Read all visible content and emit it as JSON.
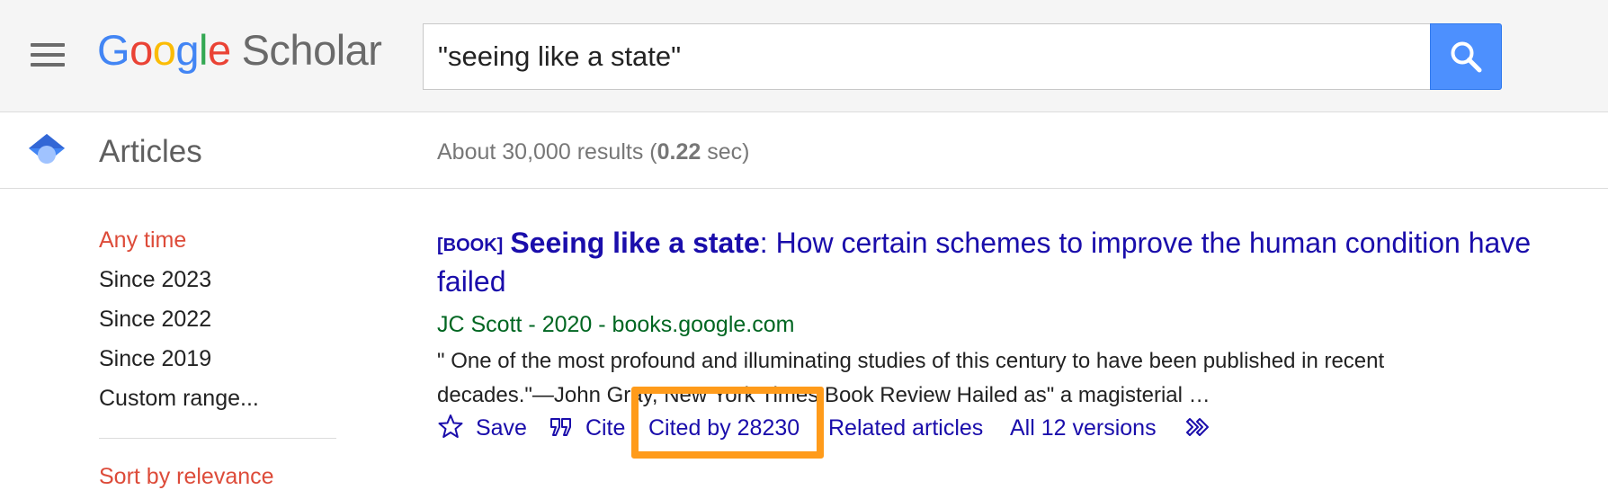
{
  "header": {
    "logo_letters": [
      "G",
      "o",
      "o",
      "g",
      "l",
      "e"
    ],
    "logo_product": "Scholar",
    "search_value": "\"seeing like a state\""
  },
  "subheader": {
    "section_label": "Articles",
    "results_prefix": "About 30,000 results (",
    "results_time": "0.22",
    "results_suffix": " sec)"
  },
  "sidebar": {
    "time_filters": [
      "Any time",
      "Since 2023",
      "Since 2022",
      "Since 2019",
      "Custom range..."
    ],
    "sort_label": "Sort by relevance"
  },
  "result": {
    "tag": "[BOOK]",
    "title_bold": "Seeing like a state",
    "title_rest": ": How certain schemes to improve the human condition have failed",
    "meta_authors": "JC Scott",
    "meta_sep1": " - ",
    "meta_year": "2020",
    "meta_sep2": " - ",
    "meta_source": "books.google.com",
    "snippet": "\" One of the most profound and illuminating studies of this century to have been published in recent decades.\"—John Gray, New York Times Book Review Hailed as\" a magisterial …",
    "actions": {
      "save": "Save",
      "cite": "Cite",
      "cited_by": "Cited by 28230",
      "related": "Related articles",
      "versions": "All 12 versions"
    }
  },
  "colors": {
    "link": "#1a0dab",
    "meta_green": "#006621",
    "active_filter": "#dd4b39",
    "search_button": "#4d90fe",
    "highlight_box": "#ff9b1a"
  }
}
